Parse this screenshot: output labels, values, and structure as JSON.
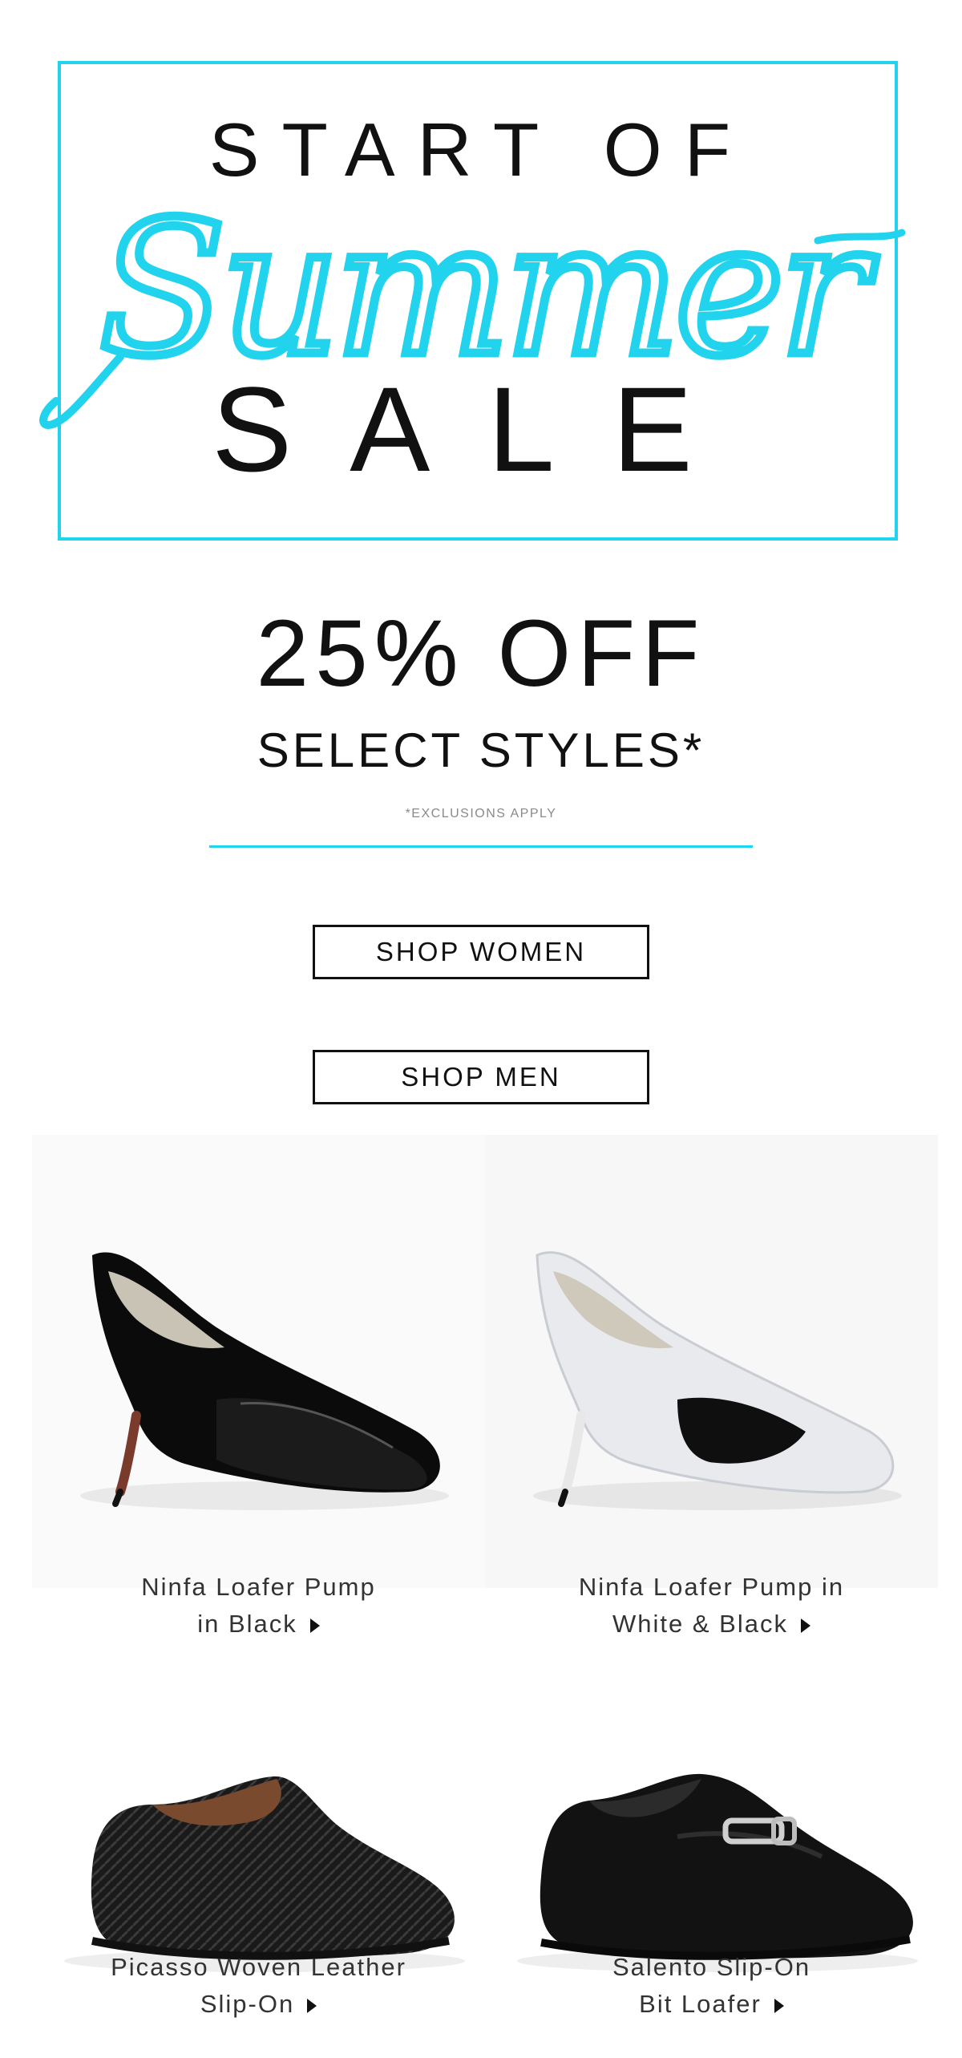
{
  "hero": {
    "line1": "START OF",
    "script": "Summer",
    "line3": "SALE",
    "accent_color": "#22d3ee"
  },
  "offer": {
    "headline": "25% OFF",
    "subline": "SELECT STYLES*",
    "note": "*EXCLUSIONS APPLY"
  },
  "buttons": {
    "shop_women": "SHOP WOMEN",
    "shop_men": "SHOP MEN"
  },
  "products": [
    {
      "line1": "Ninfa Loafer Pump",
      "line2": "in Black",
      "icon": "chevron-right-icon"
    },
    {
      "line1": "Ninfa Loafer Pump in",
      "line2": "White & Black",
      "icon": "chevron-right-icon"
    },
    {
      "line1": "Picasso Woven Leather",
      "line2": "Slip-On",
      "icon": "chevron-right-icon"
    },
    {
      "line1": "Salento Slip-On",
      "line2": "Bit Loafer",
      "icon": "chevron-right-icon"
    }
  ]
}
